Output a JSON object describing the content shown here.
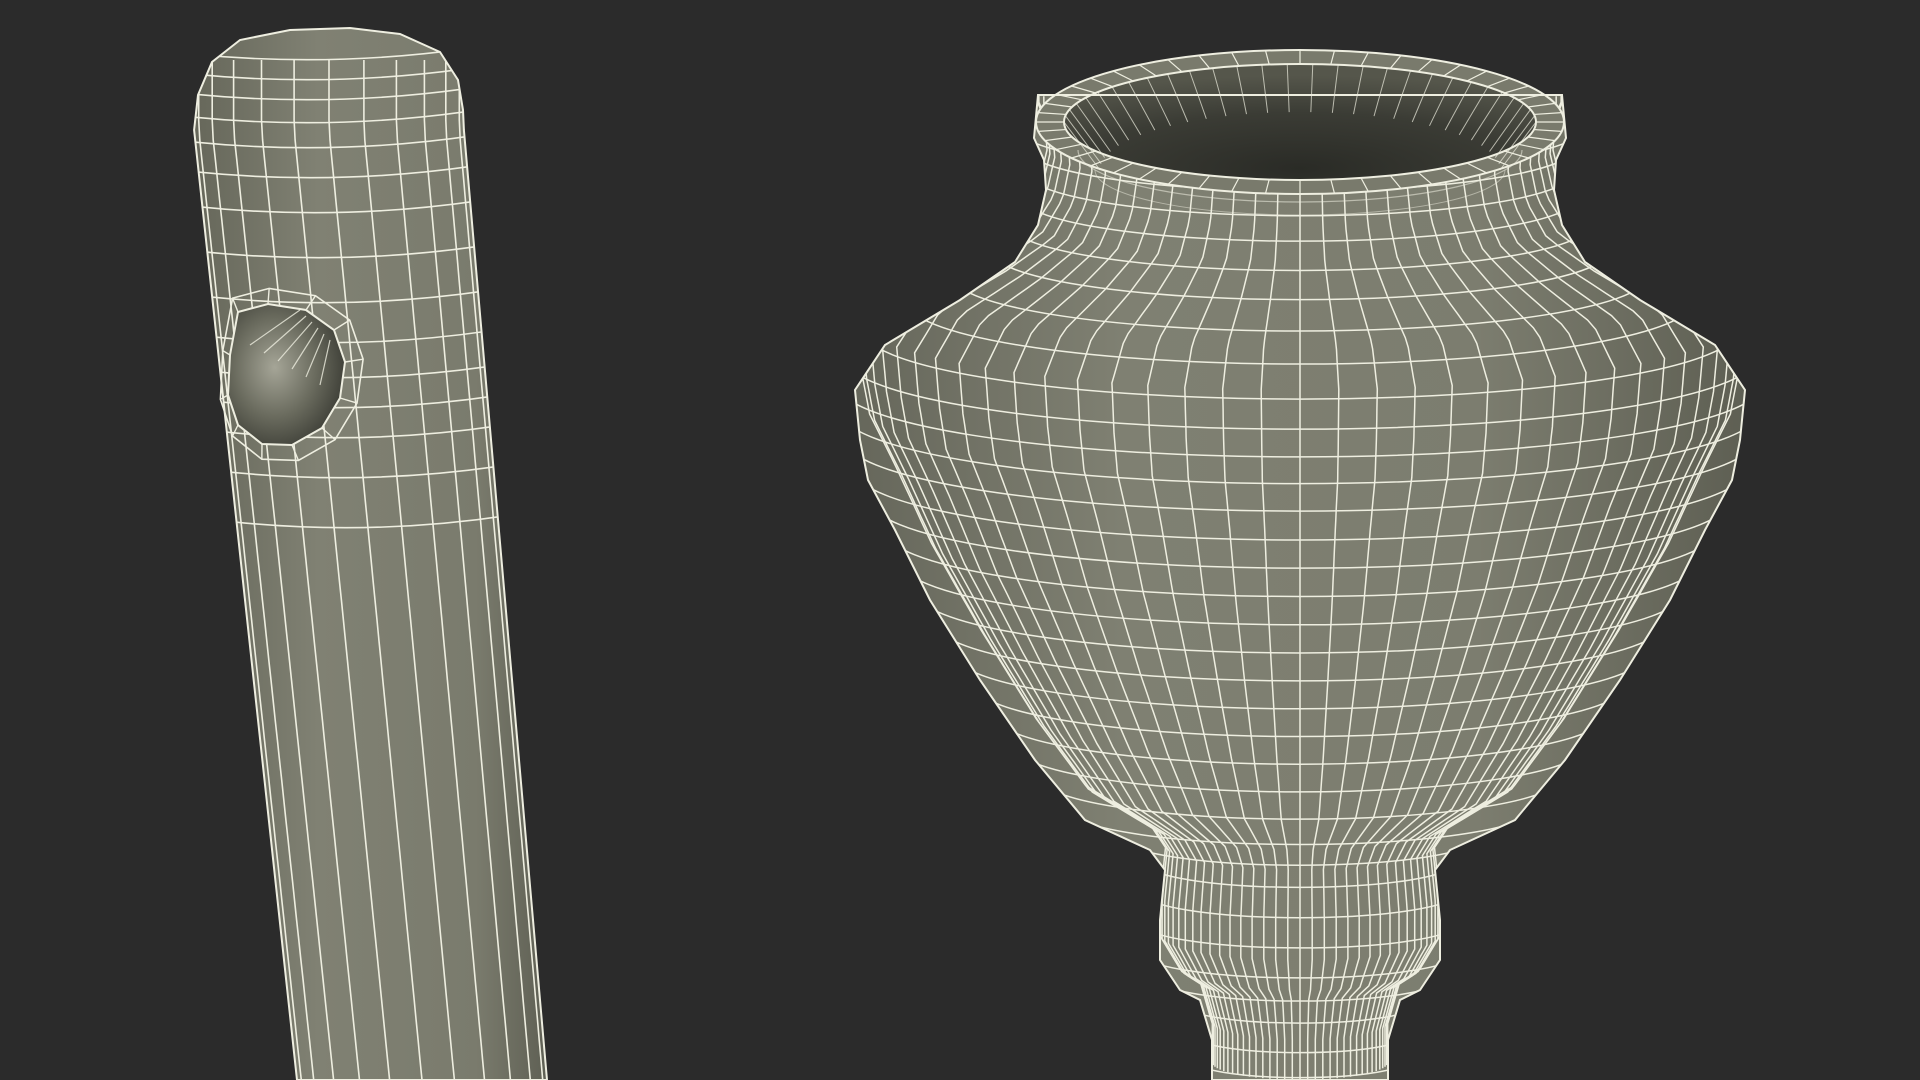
{
  "scene": {
    "background_color": "#2b2b2b",
    "surface_color": "#7b7c6e",
    "surface_dark_color": "#5a5b50",
    "cavity_dark_color": "#2e2f2a",
    "wire_color": "#eeeee0"
  },
  "objects": [
    {
      "name": "tube-with-hole",
      "kind": "rounded-cylinder-with-side-hole"
    },
    {
      "name": "cup-finial",
      "kind": "lathe-vase-with-stem"
    }
  ]
}
